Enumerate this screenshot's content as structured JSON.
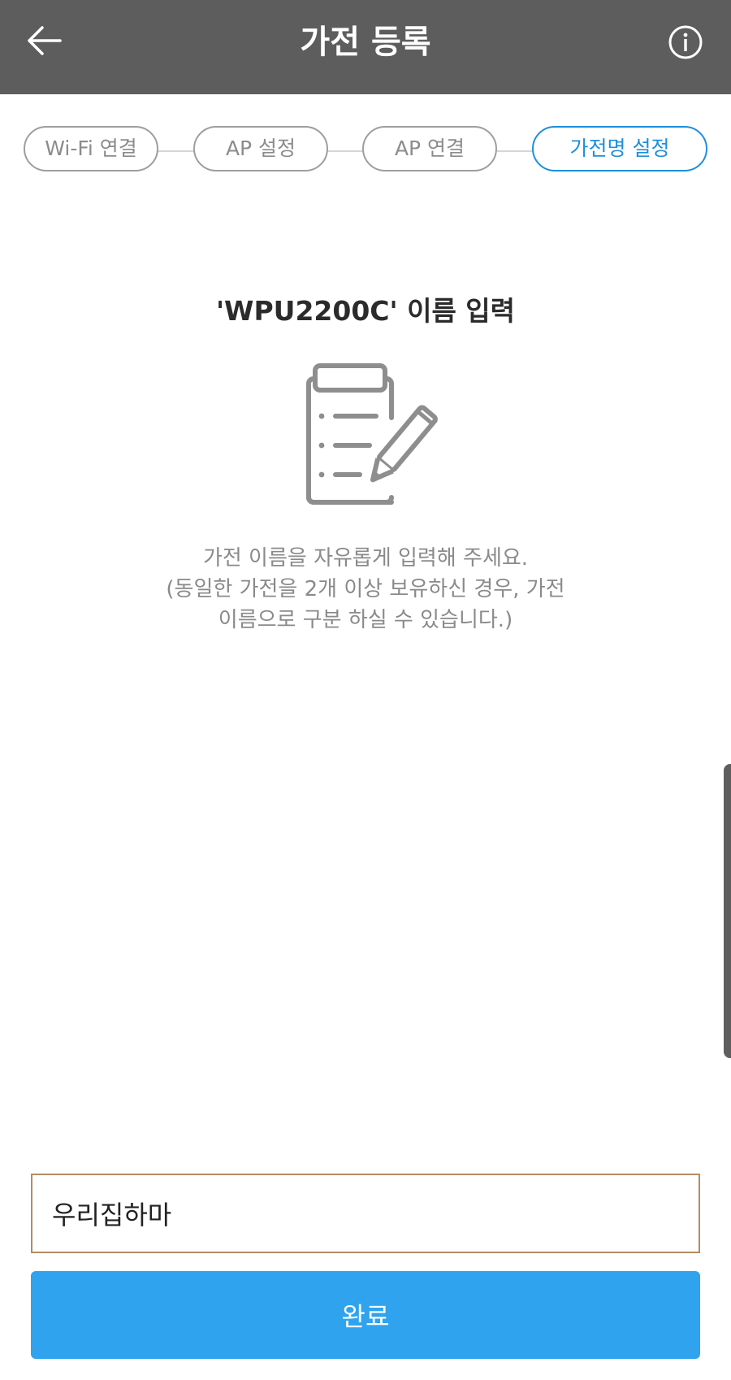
{
  "header": {
    "title": "가전 등록",
    "back_icon": "arrow-left-icon",
    "info_icon": "info-circle-icon"
  },
  "steps": [
    {
      "label": "Wi-Fi 연결",
      "active": false
    },
    {
      "label": "AP 설정",
      "active": false
    },
    {
      "label": "AP 연결",
      "active": false
    },
    {
      "label": "가전명 설정",
      "active": true
    }
  ],
  "main": {
    "heading": "'WPU2200C' 이름 입력",
    "illustration_icon": "clipboard-pencil-icon",
    "description_lines": [
      "가전 이름을 자유롭게 입력해 주세요.",
      "(동일한 가전을 2개 이상 보유하신 경우, 가전",
      "이름으로 구분 하실 수 있습니다.)"
    ]
  },
  "form": {
    "name_value": "우리집하마",
    "submit_label": "완료"
  },
  "colors": {
    "header_bg": "#5d5d5d",
    "active_step": "#1e8fdc",
    "inactive_step": "#9e9e9e",
    "button_bg": "#2fa3ee",
    "input_border": "#b58b63"
  }
}
